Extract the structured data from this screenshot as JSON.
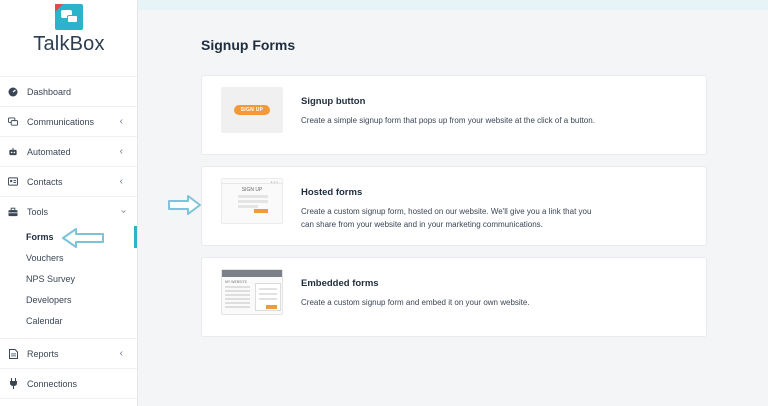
{
  "brand": {
    "name": "TalkBox"
  },
  "sidebar": {
    "items": [
      {
        "label": "Dashboard",
        "icon": "dashboard-icon"
      },
      {
        "label": "Communications",
        "icon": "chat-icon"
      },
      {
        "label": "Automated",
        "icon": "robot-icon"
      },
      {
        "label": "Contacts",
        "icon": "contacts-icon"
      },
      {
        "label": "Tools",
        "icon": "toolbox-icon"
      },
      {
        "label": "Reports",
        "icon": "report-icon"
      },
      {
        "label": "Connections",
        "icon": "plug-icon"
      }
    ],
    "tools_sub": [
      "Forms",
      "Vouchers",
      "NPS Survey",
      "Developers",
      "Calendar"
    ],
    "active_sub": "Forms"
  },
  "main": {
    "title": "Signup Forms",
    "cards": [
      {
        "title": "Signup button",
        "desc": "Create a simple signup form that pops up from your website at the click of a button.",
        "thumb_label": "SIGN UP"
      },
      {
        "title": "Hosted forms",
        "desc": "Create a custom signup form, hosted on our website. We'll give you a link that you can share from your website and in your marketing communications.",
        "thumb_label": "SIGN UP"
      },
      {
        "title": "Embedded forms",
        "desc": "Create a custom signup form and embed it on your own website.",
        "thumb_label": "MY WEBSITE"
      }
    ]
  },
  "colors": {
    "accent": "#2bb3c9",
    "orange": "#f29a3a",
    "text": "#1f2d3d"
  }
}
